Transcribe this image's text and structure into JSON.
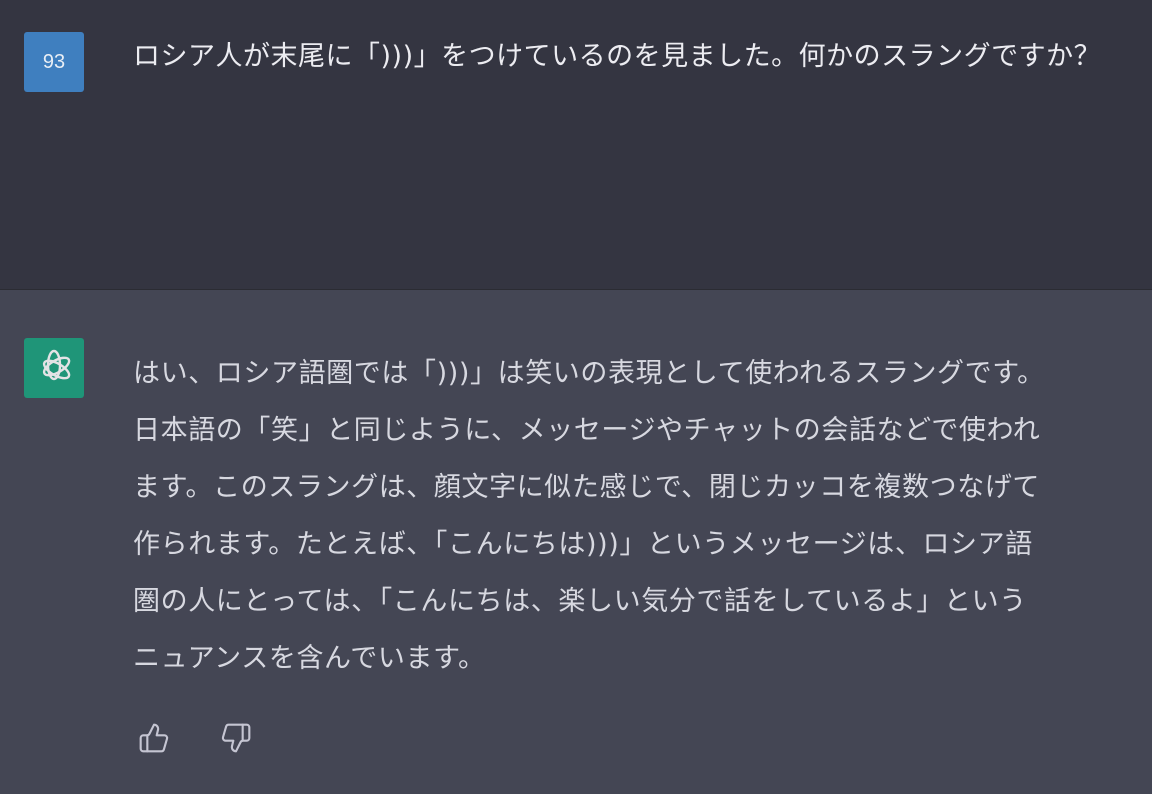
{
  "user": {
    "avatar_label": "93",
    "message": "ロシア人が末尾に「)))」をつけているのを見ました。何かのスラングですか？"
  },
  "assistant": {
    "lines": [
      "はい、ロシア語圏では「)))」は笑いの表現として使われるスラングです。",
      "日本語の「笑」と同じように、メッセージやチャットの会話などで使われ",
      "ます。このスラングは、顔文字に似た感じで、閉じカッコを複数つなげて",
      "作られます。たとえば、「こんにちは)))」というメッセージは、ロシア語",
      "圏の人にとっては、「こんにちは、楽しい気分で話をしているよ」という",
      "ニュアンスを含んでいます。"
    ]
  },
  "icons": {
    "bot_avatar": "openai-logo-icon",
    "thumbs_up": "thumbs-up-icon",
    "thumbs_down": "thumbs-down-icon"
  },
  "colors": {
    "user_bg": "#343541",
    "assistant_bg": "#444654",
    "user_avatar": "#3f7fbf",
    "bot_avatar": "#19a37f"
  }
}
